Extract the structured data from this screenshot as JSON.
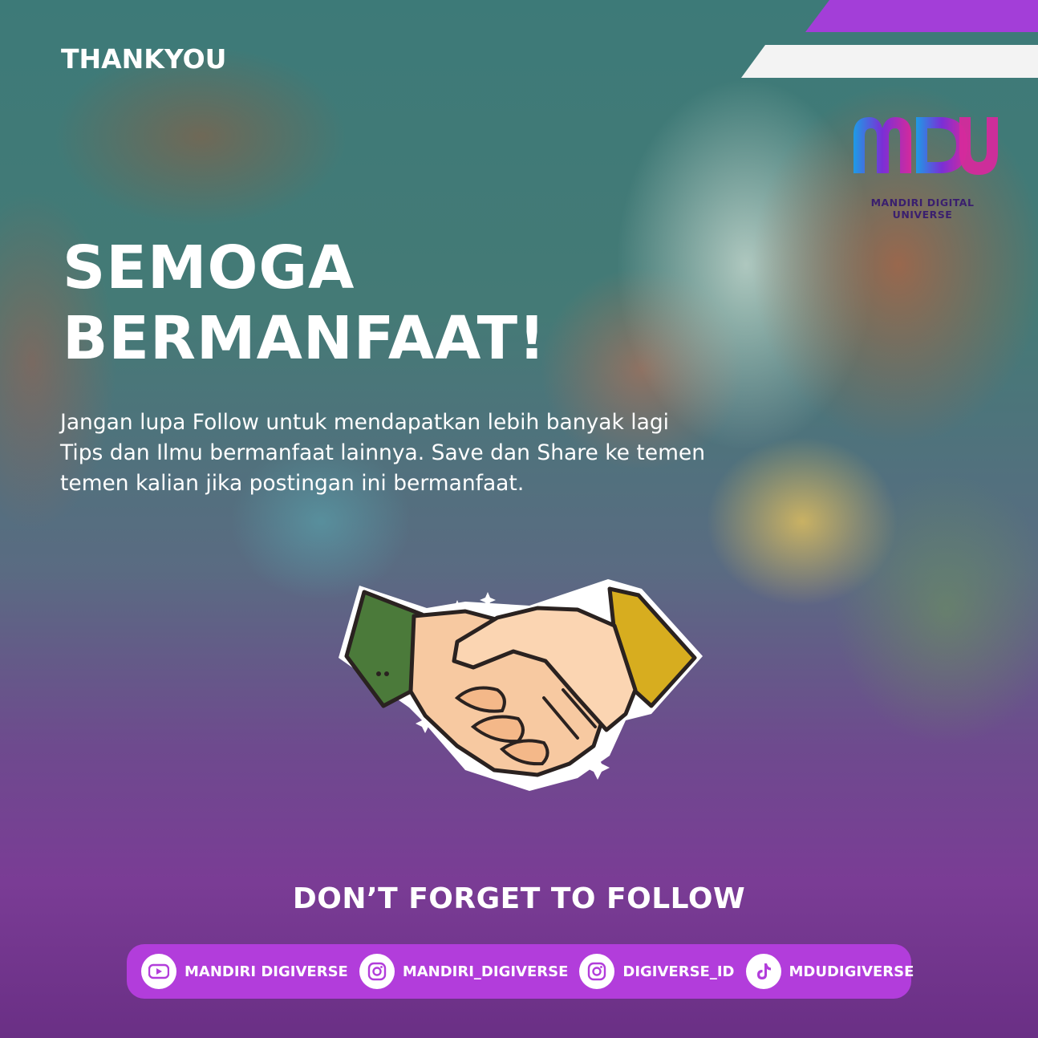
{
  "header": {
    "label": "THANKYOU"
  },
  "brand": {
    "logo_letters": "MDU",
    "name": "MANDIRI DIGITAL UNIVERSE",
    "colors": {
      "blue": "#1e8fe0",
      "purple": "#8a2bd6",
      "magenta": "#d42a9c"
    }
  },
  "headline": {
    "line1": "SEMOGA",
    "line2": "BERMANFAAT!"
  },
  "message": {
    "line1": "Jangan lupa Follow untuk mendapatkan lebih banyak lagi",
    "line2": "Tips dan Ilmu bermanfaat lainnya. Save dan Share ke temen",
    "line3": "temen kalian jika postingan ini bermanfaat."
  },
  "illustration": {
    "icon": "handshake-icon"
  },
  "footer": {
    "title": "DON’T FORGET TO FOLLOW",
    "socials": [
      {
        "icon": "youtube-icon",
        "label": "MANDIRI DIGIVERSE"
      },
      {
        "icon": "instagram-icon",
        "label": "MANDIRI_DIGIVERSE"
      },
      {
        "icon": "instagram-icon",
        "label": "DIGIVERSE_ID"
      },
      {
        "icon": "tiktok-icon",
        "label": "MDUDIGIVERSE"
      }
    ],
    "bar_color": "#b23ddb"
  }
}
